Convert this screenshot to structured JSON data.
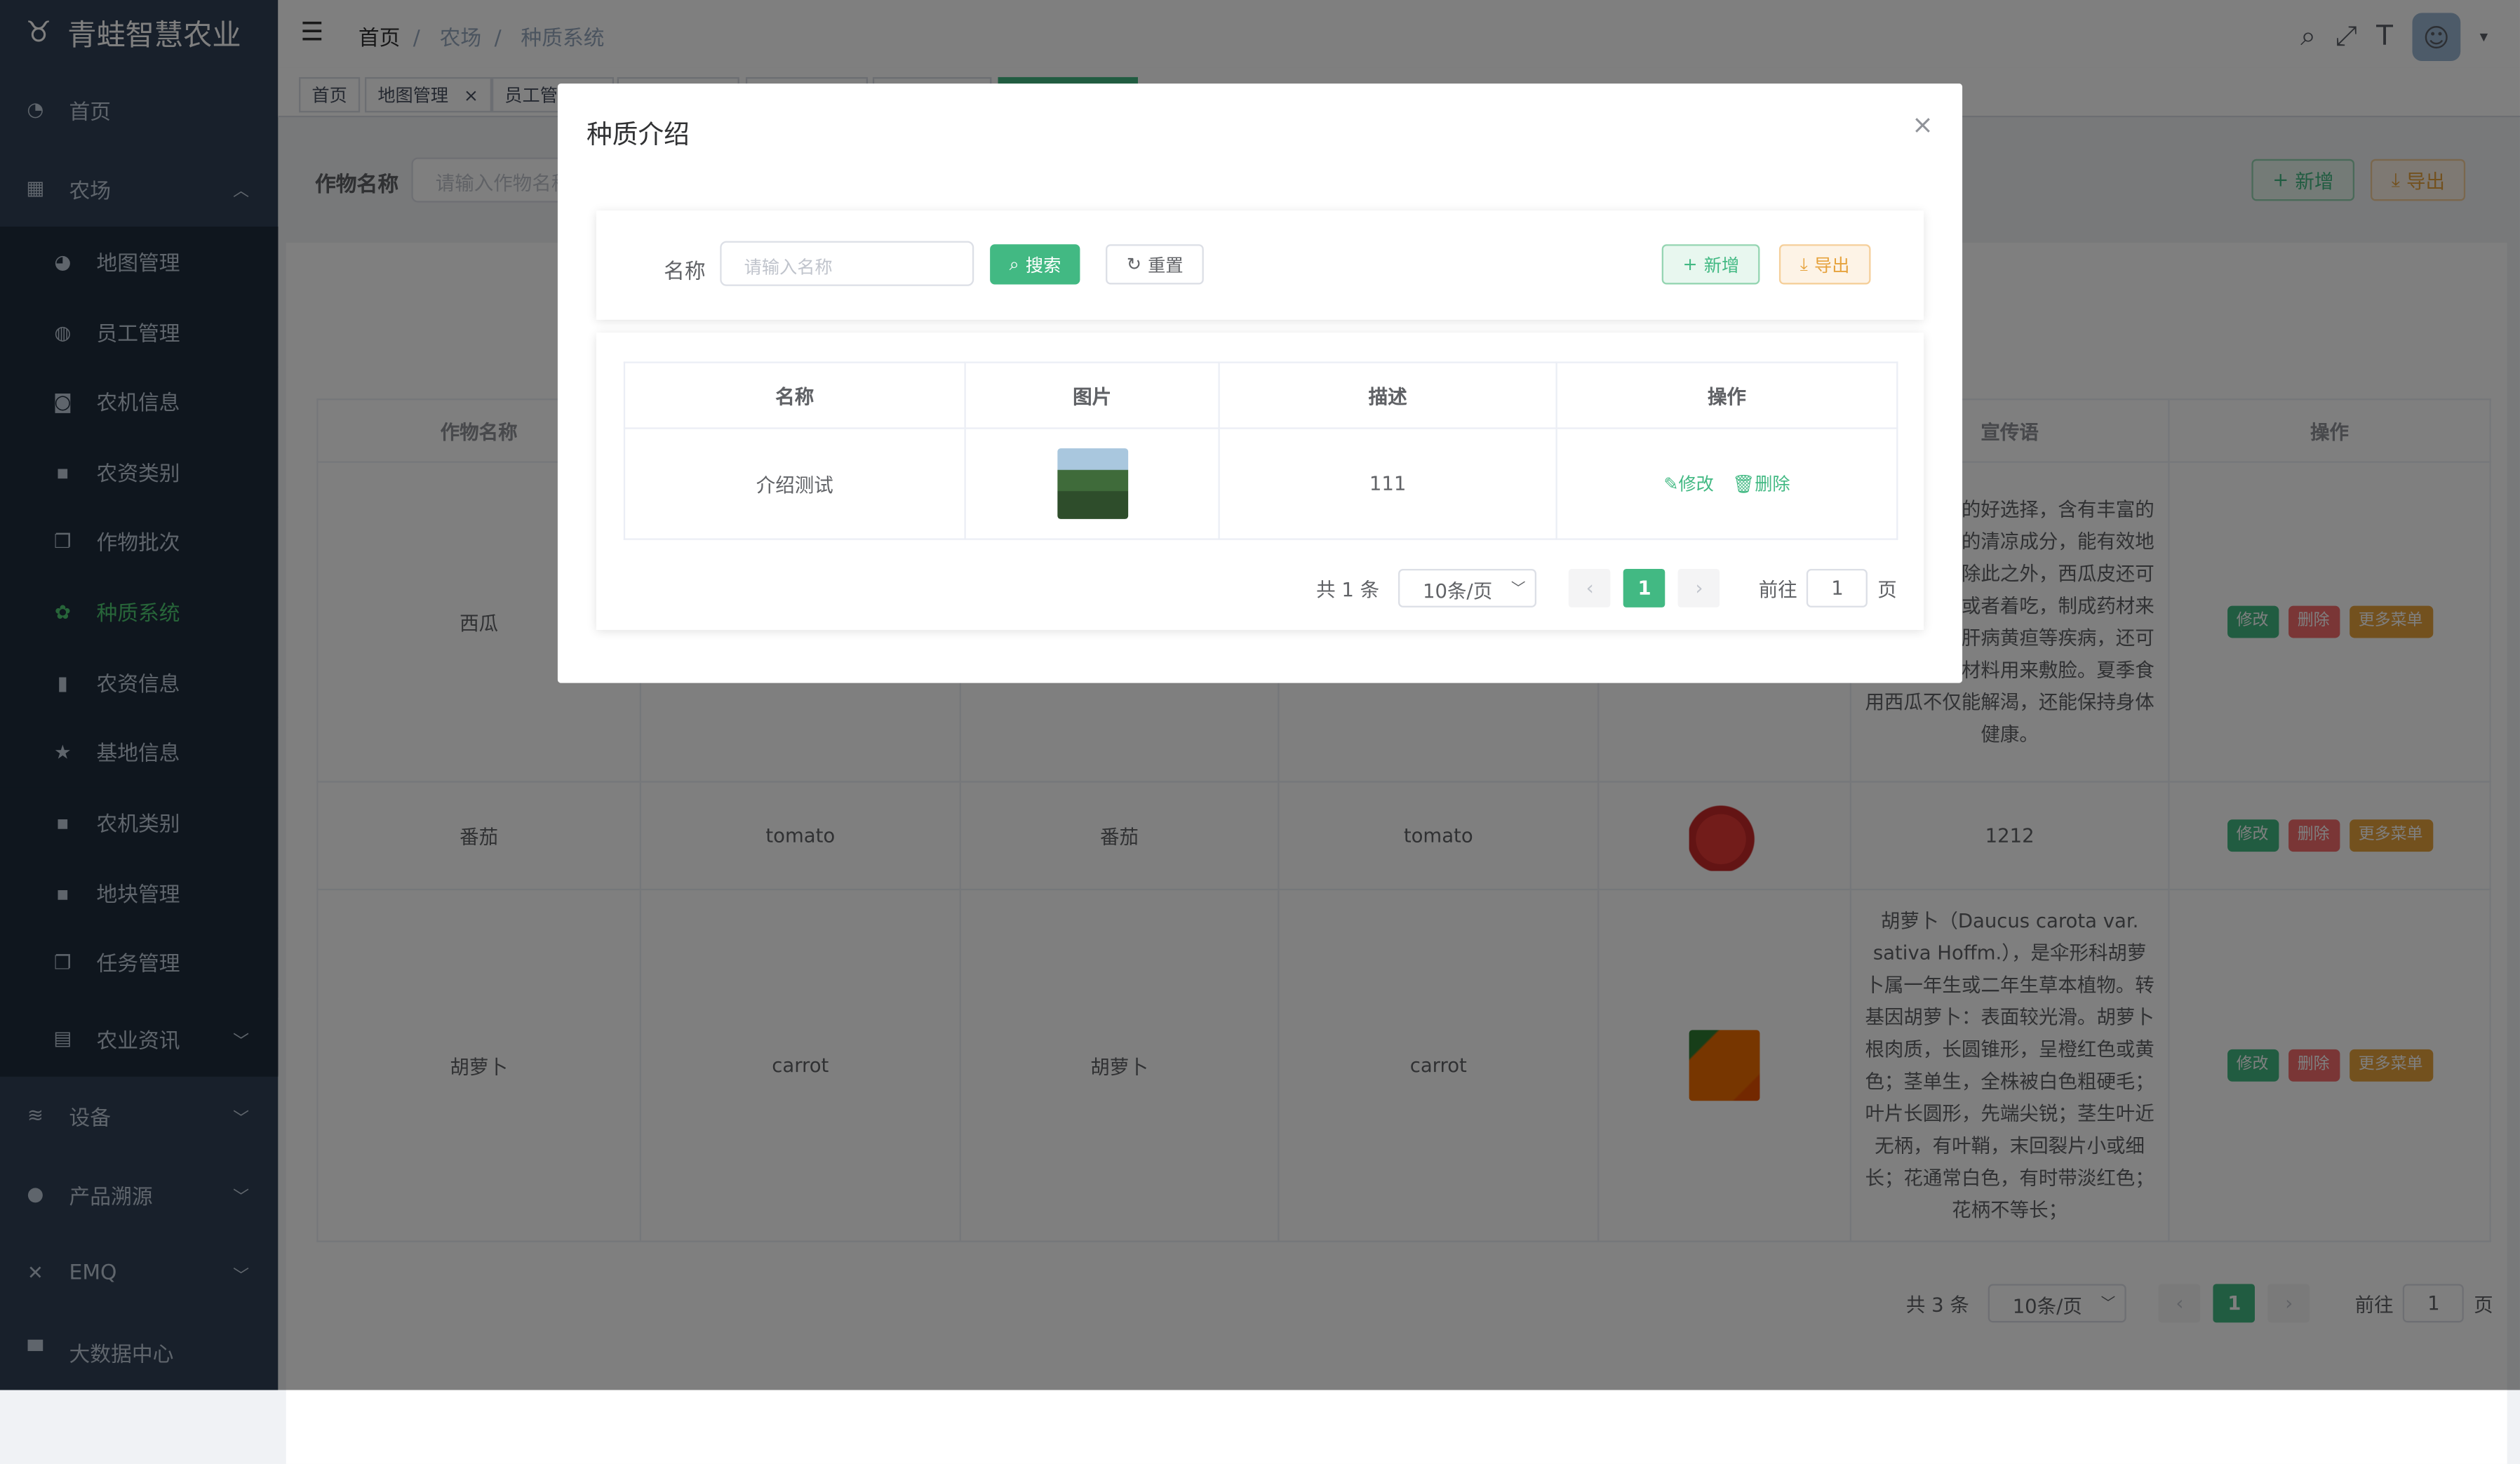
{
  "app": {
    "title": "青蛙智慧农业"
  },
  "sidebar": {
    "items": [
      {
        "label": "首页",
        "icon": "dashboard-icon"
      },
      {
        "label": "农场",
        "icon": "table-icon"
      },
      {
        "label": "地图管理",
        "icon": "globe-icon"
      },
      {
        "label": "员工管理",
        "icon": "peoples-icon"
      },
      {
        "label": "农机信息",
        "icon": "tractor-icon"
      },
      {
        "label": "农资类别",
        "icon": "grid-icon"
      },
      {
        "label": "作物批次",
        "icon": "documents-icon"
      },
      {
        "label": "种质系统",
        "icon": "sprout-icon"
      },
      {
        "label": "农资信息",
        "icon": "bottle-icon"
      },
      {
        "label": "基地信息",
        "icon": "star-icon"
      },
      {
        "label": "农机类别",
        "icon": "grid-icon"
      },
      {
        "label": "地块管理",
        "icon": "grid-icon"
      },
      {
        "label": "任务管理",
        "icon": "documents-icon"
      },
      {
        "label": "农业资讯",
        "icon": "article-icon"
      },
      {
        "label": "设备",
        "icon": "device-icon"
      },
      {
        "label": "产品溯源",
        "icon": "trace-icon"
      },
      {
        "label": "EMQ",
        "icon": "emq-icon"
      },
      {
        "label": "大数据中心",
        "icon": "monitor-icon"
      }
    ]
  },
  "header": {
    "breadcrumb": [
      "首页",
      "农场",
      "种质系统"
    ]
  },
  "tags": [
    "首页",
    "地图管理",
    "员工管"
  ],
  "main": {
    "filter_label": "作物名称",
    "filter_placeholder": "请输入作物名称",
    "add_label": "新增",
    "export_label": "导出",
    "columns": {
      "name": "作物名称",
      "slogan": "宣传语",
      "ops": "操作"
    },
    "rows": [
      {
        "name": "西瓜",
        "en": "",
        "cn": "",
        "en2": "",
        "slogan": "是夏季消暑的好选择，含有丰富的水分和天然的清凉成分，能有效地降低体温。除此之外，西瓜皮还可以用来熬汤或者着吃，制成药材来治疗肾炎、肝病黄疸等疾病，还可以作为美容材料用来敷脸。夏季食用西瓜不仅能解渴，还能保持身体健康。"
      },
      {
        "name": "番茄",
        "en": "tomato",
        "cn": "番茄",
        "en2": "tomato",
        "slogan": "1212"
      },
      {
        "name": "胡萝卜",
        "en": "carrot",
        "cn": "胡萝卜",
        "en2": "carrot",
        "slogan": "胡萝卜（Daucus carota var. sativa Hoffm.），是伞形科胡萝卜属一年生或二年生草本植物。转基因胡萝卜：表面较光滑。胡萝卜根肉质，长圆锥形，呈橙红色或黄色；茎单生，全株被白色粗硬毛；叶片长圆形，先端尖锐；茎生叶近无柄，有叶鞘，末回裂片小或细长；花通常白色，有时带淡红色；花柄不等长；"
      }
    ],
    "op_edit": "修改",
    "op_delete": "删除",
    "op_more": "更多菜单",
    "pager": {
      "total": "共 3 条",
      "size": "10条/页",
      "current": "1",
      "goto": "前往",
      "goto_value": "1",
      "page": "页"
    }
  },
  "dialog": {
    "title": "种质介绍",
    "name_label": "名称",
    "name_placeholder": "请输入名称",
    "search_label": "搜索",
    "reset_label": "重置",
    "add_label": "新增",
    "export_label": "导出",
    "columns": [
      "名称",
      "图片",
      "描述",
      "操作"
    ],
    "rows": [
      {
        "name": "介绍测试",
        "desc": "111"
      }
    ],
    "op_edit": "修改",
    "op_delete": "删除",
    "pager": {
      "total": "共 1 条",
      "size": "10条/页",
      "current": "1",
      "goto": "前往",
      "goto_value": "1",
      "page": "页"
    }
  },
  "colors": {
    "primary": "#42b983",
    "danger": "#f56c6c",
    "warning": "#e6a23c",
    "sidebar": "#304156"
  }
}
